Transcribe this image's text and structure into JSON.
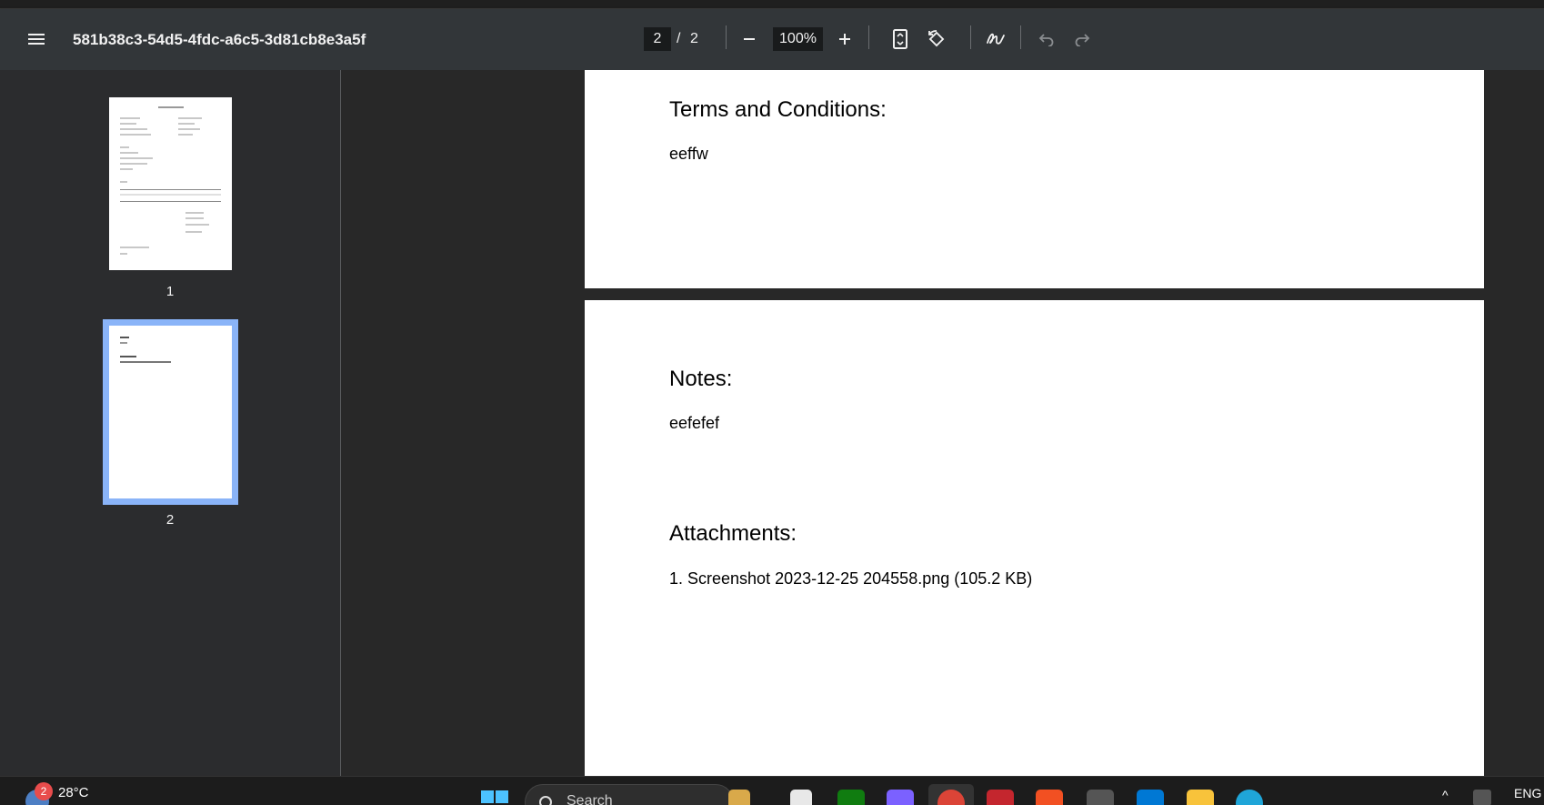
{
  "toolbar": {
    "title": "581b38c3-54d5-4fdc-a6c5-3d81cb8e3a5f",
    "current_page": "2",
    "page_separator": "/",
    "total_pages": "2",
    "zoom": "100%"
  },
  "sidebar": {
    "thumbnails": [
      {
        "label": "1",
        "selected": false
      },
      {
        "label": "2",
        "selected": true
      }
    ]
  },
  "document": {
    "page1": {
      "heading": "Terms and Conditions:",
      "body": "eeffw"
    },
    "page2": {
      "notes_heading": "Notes:",
      "notes_body": "eefefef",
      "attachments_heading": "Attachments:",
      "attachment_item": "1. Screenshot 2023-12-25 204558.png (105.2 KB)"
    }
  },
  "taskbar": {
    "weather_badge": "2",
    "temperature": "28°C",
    "search_label": "Search",
    "language": "ENG"
  },
  "colors": {
    "toolbar_bg": "#323639",
    "sidebar_bg": "#2b2c2e",
    "viewer_bg": "#282828",
    "selection": "#8ab4f8"
  }
}
